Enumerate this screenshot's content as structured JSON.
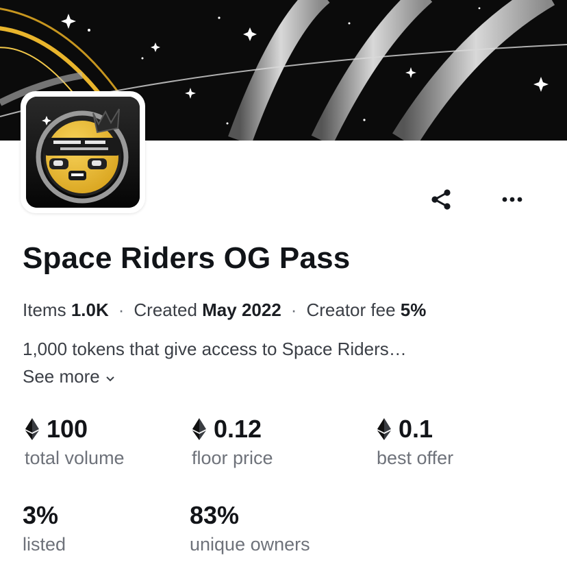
{
  "collection": {
    "title": "Space Riders OG Pass",
    "items_label": "Items",
    "items_value": "1.0K",
    "created_label": "Created",
    "created_value": "May 2022",
    "fee_label": "Creator fee",
    "fee_value": "5%",
    "description": "1,000 tokens that give access to Space Riders…",
    "see_more": "See more"
  },
  "stats": [
    {
      "value": "100",
      "label": "total volume",
      "eth": true
    },
    {
      "value": "0.12",
      "label": "floor price",
      "eth": true
    },
    {
      "value": "0.1",
      "label": "best offer",
      "eth": true
    },
    {
      "value": "3%",
      "label": "listed",
      "eth": false
    },
    {
      "value": "83%",
      "label": "unique owners",
      "eth": false
    }
  ],
  "icons": {
    "share": "share-icon",
    "more": "more-icon",
    "eth": "ethereum-icon"
  },
  "colors": {
    "banner_bg": "#0b0b0b",
    "gold": "#e9b52c",
    "text_primary": "#111418",
    "text_secondary": "#6e727a"
  }
}
